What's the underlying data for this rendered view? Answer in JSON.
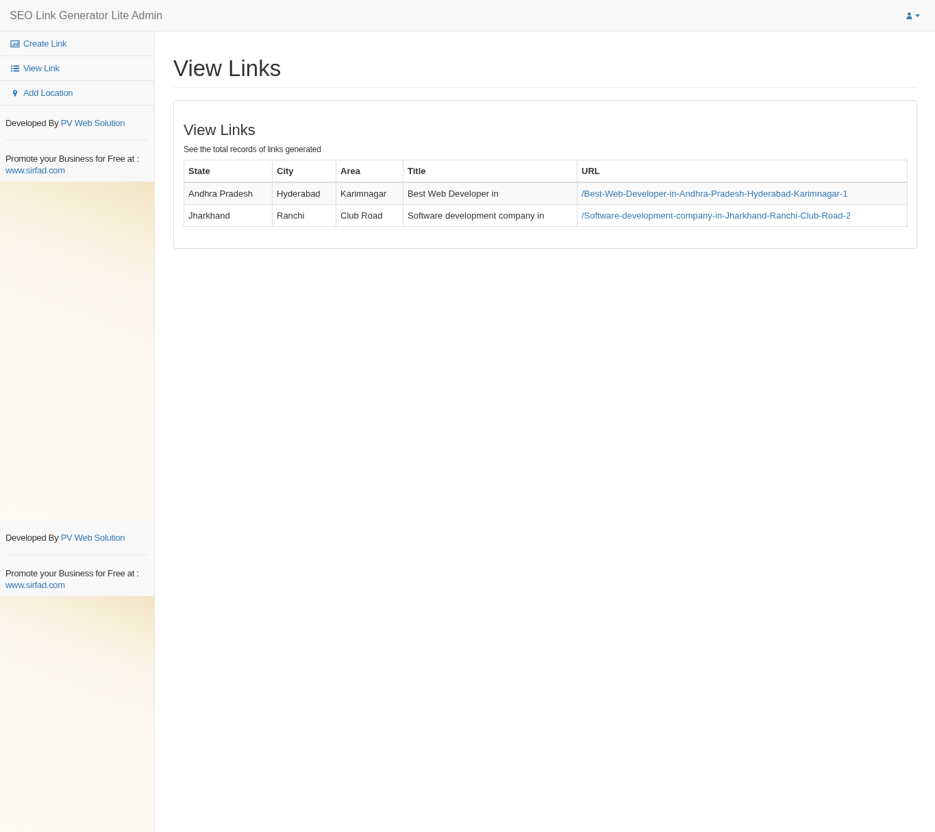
{
  "navbar": {
    "title": "SEO Link Generator Lite Admin"
  },
  "sidebar": {
    "items": [
      {
        "label": "Create Link",
        "kind": "chart"
      },
      {
        "label": "View Link",
        "kind": "list"
      },
      {
        "label": "Add Location",
        "kind": "pin"
      }
    ],
    "footers": [
      {
        "developed_by": "Developed By",
        "developer_link": "PV Web Solution",
        "promote": "Promote your Business for Free at :",
        "promote_link": "www.sirfad.com"
      },
      {
        "developed_by": "Developed By",
        "developer_link": "PV Web Solution",
        "promote": "Promote your Business for Free at :",
        "promote_link": "www.sirfad.com"
      }
    ]
  },
  "page_title": "View Links",
  "panel": {
    "title": "View Links",
    "subtitle": "See the total records of links generated",
    "table": {
      "columns": [
        {
          "label": "State",
          "kind": "text"
        },
        {
          "label": "City",
          "kind": "text"
        },
        {
          "label": "Area",
          "kind": "text"
        },
        {
          "label": "Title",
          "kind": "text"
        },
        {
          "label": "URL",
          "kind": "link"
        }
      ],
      "rows": [
        [
          "Andhra Pradesh",
          "Hyderabad",
          "Karimnagar",
          "Best Web Developer in",
          "/Best-Web-Developer-in-Andhra-Pradesh-Hyderabad-Karimnagar-1"
        ],
        [
          "Jharkhand",
          "Ranchi",
          "Club Road",
          "Software development company in",
          "/Software-development-company-in-Jharkhand-Ranchi-Club-Road-2"
        ]
      ]
    }
  }
}
